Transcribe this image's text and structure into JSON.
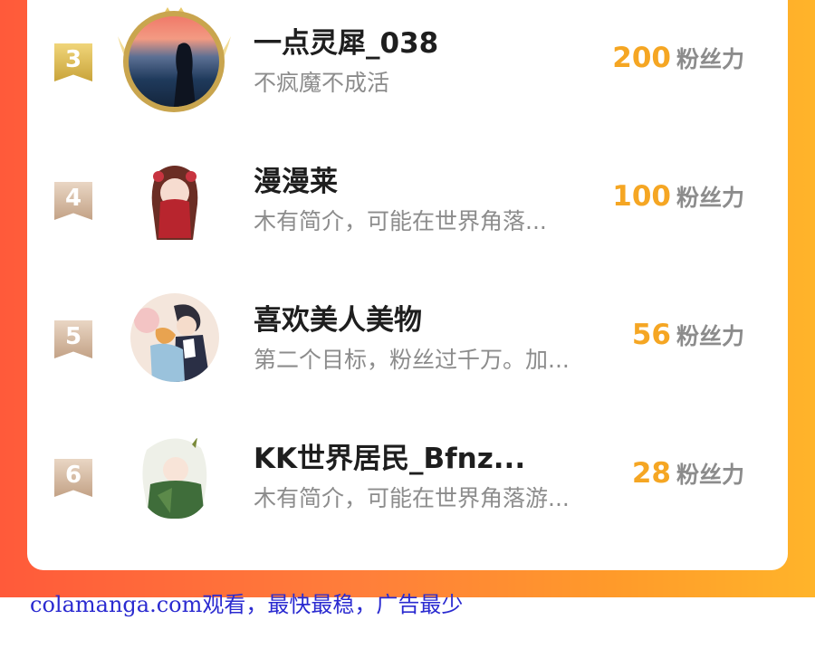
{
  "leaderboard": {
    "entries": [
      {
        "rank": "3",
        "name": "一点灵犀_038",
        "bio": "不疯魔不成活",
        "score": "200",
        "unit": "粉丝力"
      },
      {
        "rank": "4",
        "name": "漫漫莱",
        "bio": "木有简介，可能在世界角落...",
        "score": "100",
        "unit": "粉丝力"
      },
      {
        "rank": "5",
        "name": "喜欢美人美物",
        "bio": "第二个目标，粉丝过千万。加...",
        "score": "56",
        "unit": "粉丝力"
      },
      {
        "rank": "6",
        "name": "KK世界居民_Bfnz...",
        "bio": "木有简介，可能在世界角落游...",
        "score": "28",
        "unit": "粉丝力"
      }
    ]
  },
  "watermark": "colamanga.com观看，最快最稳，广告最少",
  "colors": {
    "accent": "#f5a623",
    "gradient_start": "#ff5a3a",
    "gradient_end": "#ffb42a",
    "watermark": "#2a2ad0"
  }
}
